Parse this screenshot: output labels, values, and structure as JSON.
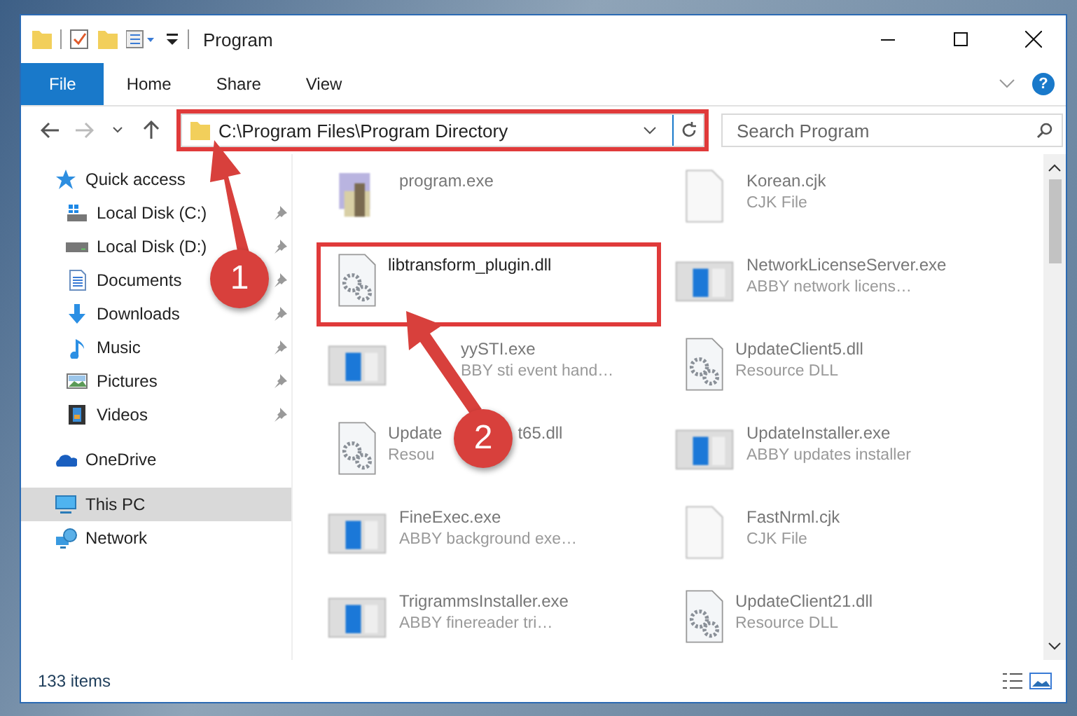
{
  "window": {
    "title": "Program"
  },
  "ribbon": {
    "tabs": [
      {
        "label": "File",
        "selected": true
      },
      {
        "label": "Home",
        "selected": false
      },
      {
        "label": "Share",
        "selected": false
      },
      {
        "label": "View",
        "selected": false
      }
    ],
    "help": "?"
  },
  "address": {
    "path": "C:\\Program Files\\Program Directory",
    "highlighted": true
  },
  "search": {
    "placeholder": "Search Program"
  },
  "sidebar": {
    "items": [
      {
        "label": "Quick access",
        "kind": "star",
        "selected": false,
        "children": [
          {
            "label": "Local Disk (C:)",
            "kind": "windows-drive",
            "pinned": true,
            "selected": false
          },
          {
            "label": "Local Disk (D:)",
            "kind": "drive",
            "pinned": true,
            "selected": false
          },
          {
            "label": "Documents",
            "kind": "document",
            "pinned": true,
            "selected": false
          },
          {
            "label": "Downloads",
            "kind": "download",
            "pinned": true,
            "selected": false
          },
          {
            "label": "Music",
            "kind": "music",
            "pinned": true,
            "selected": false
          },
          {
            "label": "Pictures",
            "kind": "pictures",
            "pinned": true,
            "selected": false
          },
          {
            "label": "Videos",
            "kind": "videos",
            "pinned": true,
            "selected": false
          }
        ]
      },
      {
        "label": "OneDrive",
        "kind": "cloud",
        "selected": false
      },
      {
        "label": "This PC",
        "kind": "computer",
        "selected": true
      },
      {
        "label": "Network",
        "kind": "network",
        "selected": false
      }
    ]
  },
  "files": [
    {
      "name_parts": [
        "program.exe"
      ],
      "kind": "installer",
      "selected": false
    },
    {
      "name_parts": [
        "Korean.cjk"
      ],
      "subtitle": "CJK File",
      "kind": "document",
      "selected": false
    },
    {
      "name_parts": [
        "libtransform_plugin.dll"
      ],
      "kind": "dll",
      "selected": true,
      "highlighted": true
    },
    {
      "name_parts": [
        "NetworkLicenseServer.exe"
      ],
      "subtitle": "ABBY network licens…",
      "kind": "app",
      "selected": false
    },
    {
      "name_parts": [
        "yySTI.exe"
      ],
      "subtitle": "BBY sti event hand…",
      "kind": "app",
      "selected": false,
      "covered": true
    },
    {
      "name_parts": [
        "UpdateClient5.dll"
      ],
      "subtitle": "Resource DLL",
      "kind": "dll",
      "selected": false
    },
    {
      "name_parts": [
        "Update",
        "t65.dll"
      ],
      "subtitle": "Resou",
      "kind": "dll",
      "selected": false
    },
    {
      "name_parts": [
        "UpdateInstaller.exe"
      ],
      "subtitle": "ABBY updates installer",
      "kind": "app",
      "selected": false
    },
    {
      "name_parts": [
        "FineExec.exe"
      ],
      "subtitle": "ABBY background exe…",
      "kind": "app",
      "selected": false
    },
    {
      "name_parts": [
        "FastNrml.cjk"
      ],
      "subtitle": "CJK File",
      "kind": "document",
      "selected": false
    },
    {
      "name_parts": [
        "TrigrammsInstaller.exe"
      ],
      "subtitle": "ABBY finereader tri…",
      "kind": "app",
      "selected": false
    },
    {
      "name_parts": [
        "UpdateClient21.dll"
      ],
      "subtitle": "Resource DLL",
      "kind": "dll",
      "selected": false
    }
  ],
  "callouts": [
    {
      "number": "1"
    },
    {
      "number": "2"
    }
  ],
  "status_bar": {
    "item_count": "133 items"
  }
}
